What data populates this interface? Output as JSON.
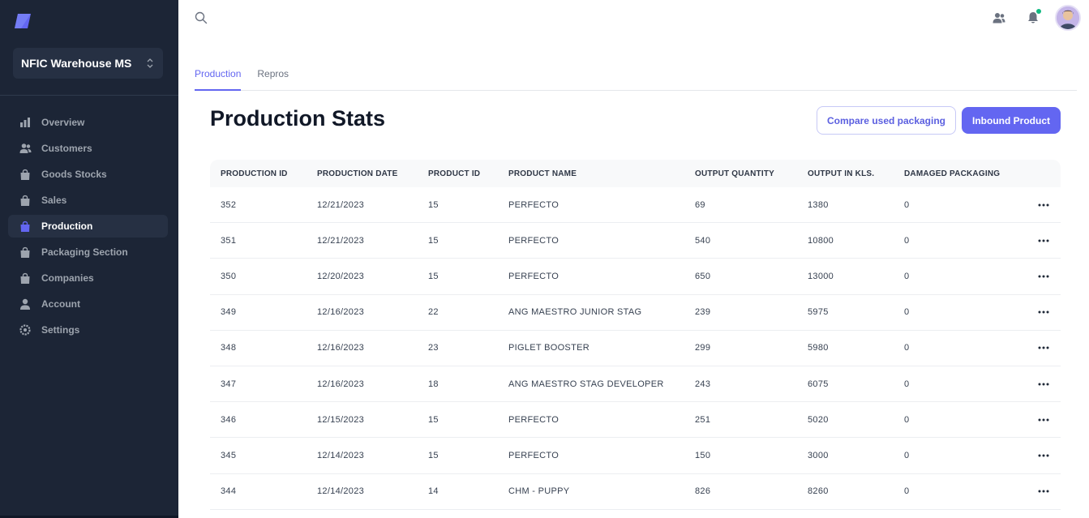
{
  "sidebar": {
    "workspace_name": "NFIC Warehouse MS",
    "items": [
      {
        "label": "Overview",
        "icon": "bar-chart-icon"
      },
      {
        "label": "Customers",
        "icon": "users-icon"
      },
      {
        "label": "Goods Stocks",
        "icon": "shopping-bag-icon"
      },
      {
        "label": "Sales",
        "icon": "shopping-bag-icon"
      },
      {
        "label": "Production",
        "icon": "shopping-bag-icon"
      },
      {
        "label": "Packaging Section",
        "icon": "shopping-bag-icon"
      },
      {
        "label": "Companies",
        "icon": "shopping-bag-icon"
      },
      {
        "label": "Account",
        "icon": "user-icon"
      },
      {
        "label": "Settings",
        "icon": "gear-icon"
      }
    ],
    "active_item": "Production"
  },
  "tabs": [
    {
      "label": "Production"
    },
    {
      "label": "Repros"
    }
  ],
  "page": {
    "title": "Production Stats",
    "compare_button": "Compare used packaging",
    "inbound_button": "Inbound Product"
  },
  "table": {
    "columns": [
      "PRODUCTION ID",
      "PRODUCTION DATE",
      "PRODUCT ID",
      "PRODUCT NAME",
      "OUTPUT QUANTITY",
      "OUTPUT IN KLS.",
      "DAMAGED PACKAGING"
    ],
    "rows": [
      [
        "352",
        "12/21/2023",
        "15",
        "PERFECTO",
        "69",
        "1380",
        "0"
      ],
      [
        "351",
        "12/21/2023",
        "15",
        "PERFECTO",
        "540",
        "10800",
        "0"
      ],
      [
        "350",
        "12/20/2023",
        "15",
        "PERFECTO",
        "650",
        "13000",
        "0"
      ],
      [
        "349",
        "12/16/2023",
        "22",
        "ANG MAESTRO JUNIOR STAG",
        "239",
        "5975",
        "0"
      ],
      [
        "348",
        "12/16/2023",
        "23",
        "PIGLET BOOSTER",
        "299",
        "5980",
        "0"
      ],
      [
        "347",
        "12/16/2023",
        "18",
        "ANG MAESTRO STAG DEVELOPER",
        "243",
        "6075",
        "0"
      ],
      [
        "346",
        "12/15/2023",
        "15",
        "PERFECTO",
        "251",
        "5020",
        "0"
      ],
      [
        "345",
        "12/14/2023",
        "15",
        "PERFECTO",
        "150",
        "3000",
        "0"
      ],
      [
        "344",
        "12/14/2023",
        "14",
        "CHM - PUPPY",
        "826",
        "8260",
        "0"
      ]
    ]
  },
  "colors": {
    "sidebar_bg": "#1c2536",
    "accent": "#6366f1",
    "notification_dot": "#10b981"
  }
}
